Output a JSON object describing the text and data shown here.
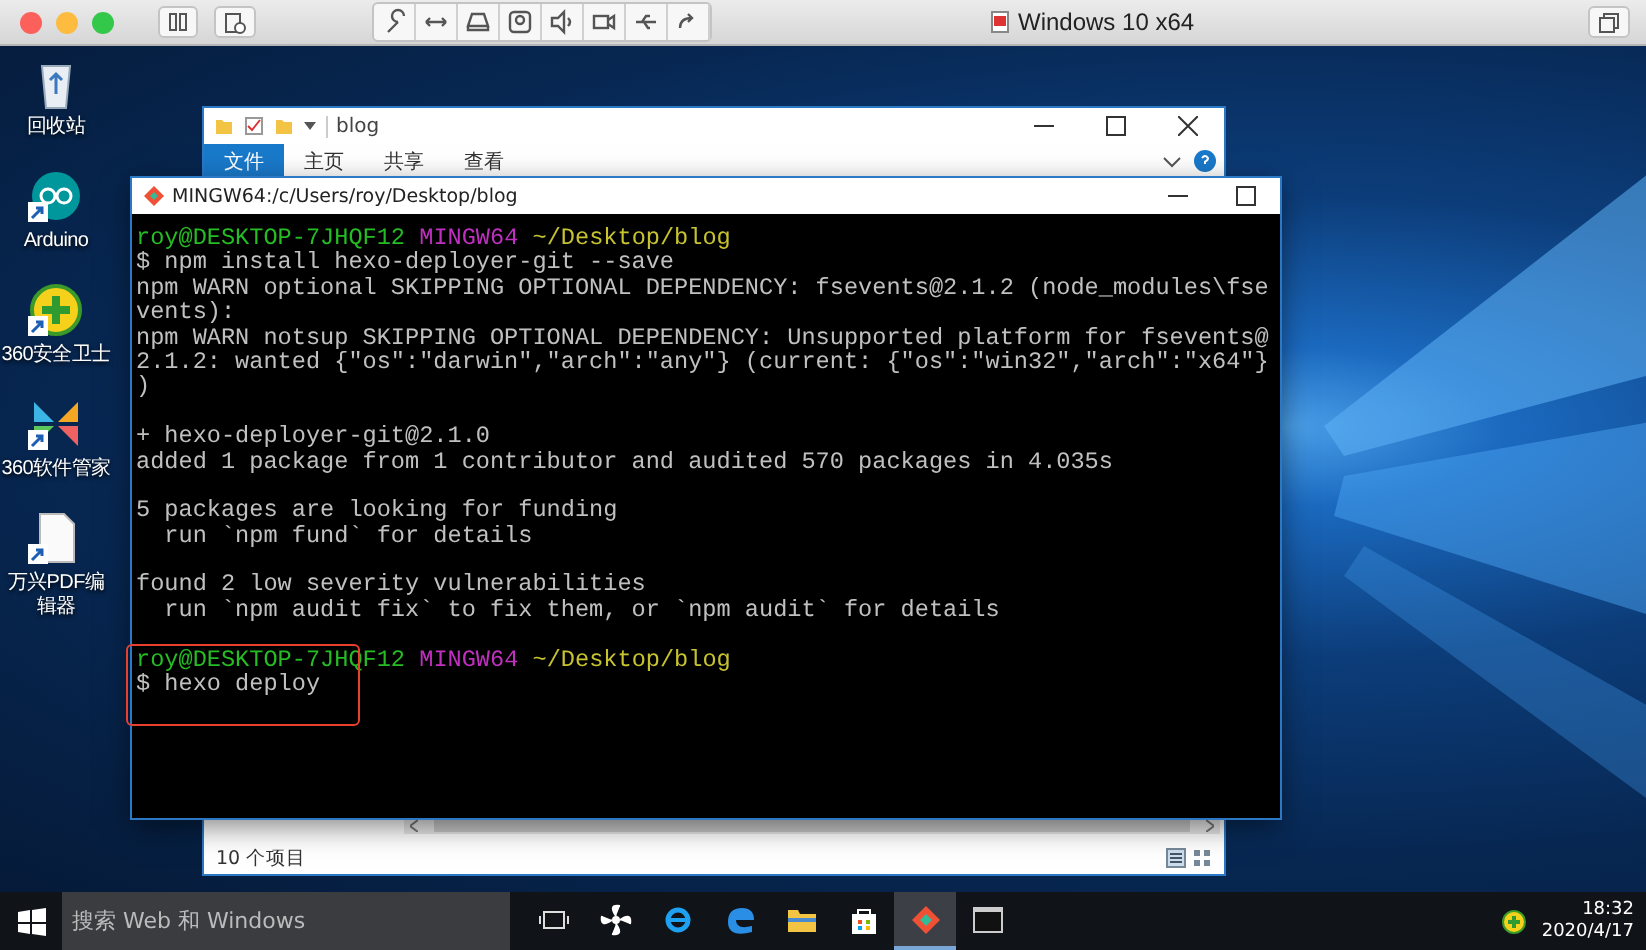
{
  "vm_window": {
    "title": "Windows 10 x64"
  },
  "desktop_icons": [
    {
      "label": "回收站",
      "kind": "recycle"
    },
    {
      "label": "Arduino",
      "kind": "arduino"
    },
    {
      "label": "360安全卫士",
      "kind": "guard"
    },
    {
      "label": "360软件管家",
      "kind": "store"
    },
    {
      "label": "万兴PDF编辑器",
      "kind": "document"
    }
  ],
  "explorer": {
    "title": "blog",
    "ribbon_tabs": [
      {
        "label": "文件",
        "selected": true
      },
      {
        "label": "主页",
        "selected": false
      },
      {
        "label": "共享",
        "selected": false
      },
      {
        "label": "查看",
        "selected": false
      }
    ],
    "status": "10 个项目"
  },
  "terminal": {
    "title": "MINGW64:/c/Users/roy/Desktop/blog",
    "highlight_last_prompt": true,
    "lines": [
      {
        "kind": "prompt",
        "user": "roy@DESKTOP-7JHQF12",
        "env": "MINGW64",
        "path": "~/Desktop/blog"
      },
      {
        "kind": "text",
        "text": "$ npm install hexo-deployer-git --save"
      },
      {
        "kind": "text",
        "text": "npm WARN optional SKIPPING OPTIONAL DEPENDENCY: fsevents@2.1.2 (node_modules\\fse"
      },
      {
        "kind": "text",
        "text": "vents):"
      },
      {
        "kind": "text",
        "text": "npm WARN notsup SKIPPING OPTIONAL DEPENDENCY: Unsupported platform for fsevents@"
      },
      {
        "kind": "text",
        "text": "2.1.2: wanted {\"os\":\"darwin\",\"arch\":\"any\"} (current: {\"os\":\"win32\",\"arch\":\"x64\"}"
      },
      {
        "kind": "text",
        "text": ")"
      },
      {
        "kind": "blank"
      },
      {
        "kind": "text",
        "text": "+ hexo-deployer-git@2.1.0"
      },
      {
        "kind": "text",
        "text": "added 1 package from 1 contributor and audited 570 packages in 4.035s"
      },
      {
        "kind": "blank"
      },
      {
        "kind": "text",
        "text": "5 packages are looking for funding"
      },
      {
        "kind": "text",
        "text": "  run `npm fund` for details"
      },
      {
        "kind": "blank"
      },
      {
        "kind": "text",
        "text": "found 2 low severity vulnerabilities"
      },
      {
        "kind": "text",
        "text": "  run `npm audit fix` to fix them, or `npm audit` for details"
      },
      {
        "kind": "blank"
      },
      {
        "kind": "prompt",
        "user": "roy@DESKTOP-7JHQF12",
        "env": "MINGW64",
        "path": "~/Desktop/blog"
      },
      {
        "kind": "text",
        "text": "$ hexo deploy"
      }
    ]
  },
  "taskbar": {
    "search_placeholder": "搜索 Web 和 Windows",
    "time": "18:32",
    "date": "2020/4/17"
  }
}
